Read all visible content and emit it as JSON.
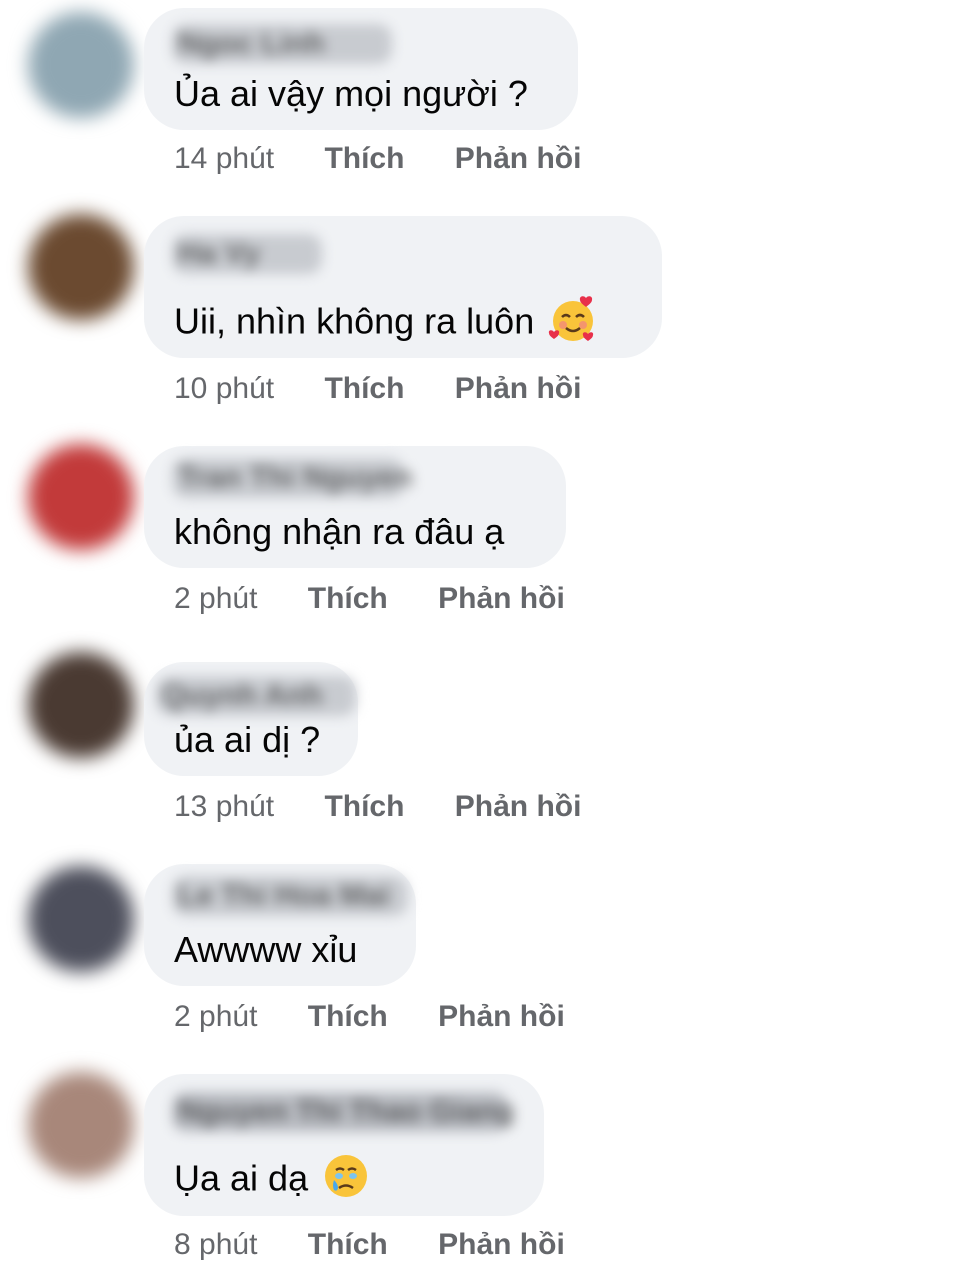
{
  "comments": [
    {
      "author_blurred": "Ngoc Linh",
      "text": "Ủa ai vậy mọi người ?",
      "time": "14 phút",
      "like": "Thích",
      "reply": "Phản hồi",
      "avatar_color": "#8fa7b3",
      "emoji": ""
    },
    {
      "author_blurred": "Ha Vy",
      "text": "Uii, nhìn không ra luôn",
      "time": "10 phút",
      "like": "Thích",
      "reply": "Phản hồi",
      "avatar_color": "#6b4a30",
      "emoji": "smiling-face-with-hearts"
    },
    {
      "author_blurred": "Tran Thi Nguyen",
      "text": "không nhận ra đâu ạ",
      "time": "2 phút",
      "like": "Thích",
      "reply": "Phản hồi",
      "avatar_color": "#c23a3a",
      "emoji": ""
    },
    {
      "author_blurred": "Quynh Anh",
      "text": "ủa ai dị ?",
      "time": "13 phút",
      "like": "Thích",
      "reply": "Phản hồi",
      "avatar_color": "#4a3a32",
      "emoji": ""
    },
    {
      "author_blurred": "Le Thi Hoa Mai",
      "text": "Awwww xỉu",
      "time": "2 phút",
      "like": "Thích",
      "reply": "Phản hồi",
      "avatar_color": "#4d4f5c",
      "emoji": ""
    },
    {
      "author_blurred": "Nguyen Thi Thao Giang",
      "text": "Ụa ai dạ",
      "time": "8 phút",
      "like": "Thích",
      "reply": "Phản hồi",
      "avatar_color": "#a8877a",
      "emoji": "face-holding-back-tears"
    }
  ]
}
